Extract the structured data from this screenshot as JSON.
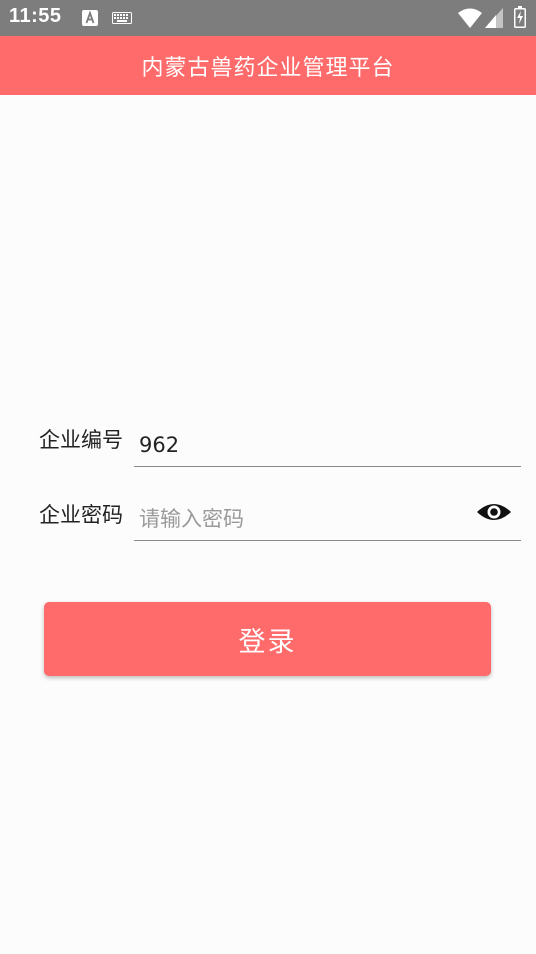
{
  "status_bar": {
    "time": "11:55",
    "icons": [
      "font-notification-icon",
      "keyboard-icon",
      "wifi-icon",
      "signal-icon",
      "battery-icon"
    ]
  },
  "app_bar": {
    "title": "内蒙古兽药企业管理平台",
    "background": "#ff6a6a"
  },
  "form": {
    "company_id": {
      "label": "企业编号",
      "value": "962"
    },
    "password": {
      "label": "企业密码",
      "placeholder": "请输入密码",
      "toggle_icon": "eye-icon"
    },
    "login_label": "登录"
  },
  "colors": {
    "accent": "#ff6a6a",
    "status_bar": "#7d7d7d",
    "background": "#fcfcfc"
  }
}
